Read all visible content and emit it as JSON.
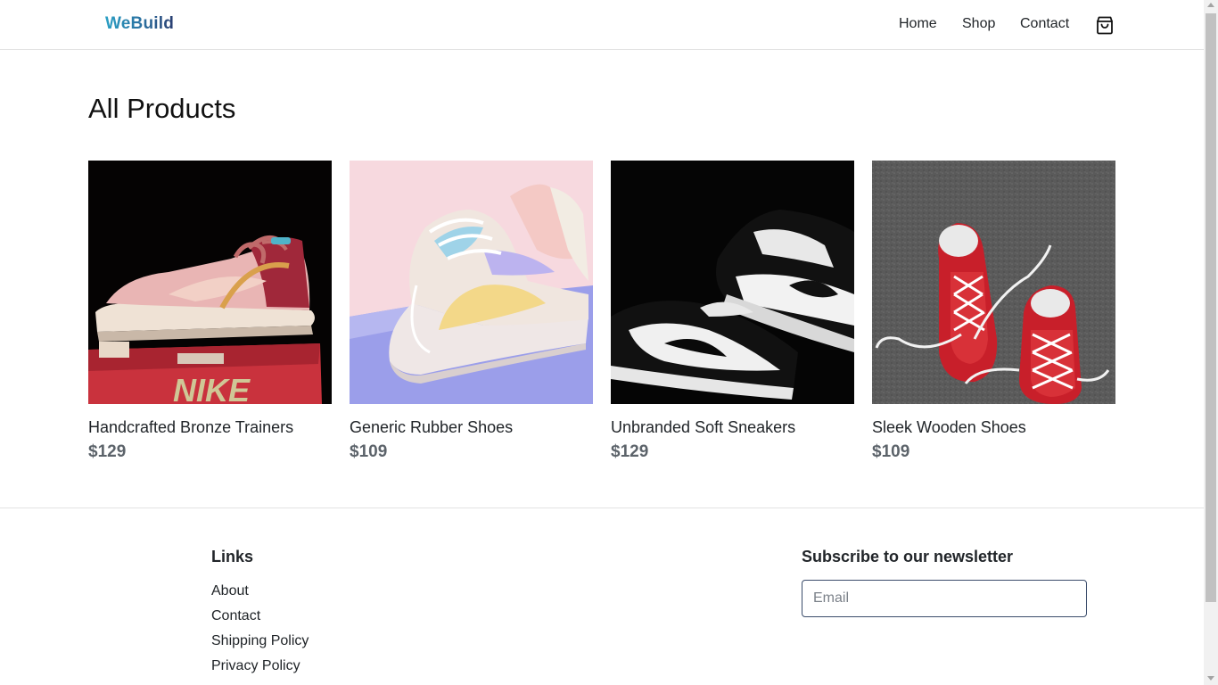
{
  "header": {
    "logo": "WeBuild",
    "nav": [
      "Home",
      "Shop",
      "Contact"
    ],
    "cart_icon": "shopping-bag-icon"
  },
  "main": {
    "title": "All Products",
    "products": [
      {
        "name": "Handcrafted Bronze Trainers",
        "price": "$129",
        "image": "pink-nike-dunk-on-shoebox"
      },
      {
        "name": "Generic Rubber Shoes",
        "price": "$109",
        "image": "pastel-nike-air-force-1"
      },
      {
        "name": "Unbranded Soft Sneakers",
        "price": "$129",
        "image": "black-white-nike-dunk"
      },
      {
        "name": "Sleek Wooden Shoes",
        "price": "$109",
        "image": "red-converse-sneakers"
      }
    ]
  },
  "footer": {
    "links_heading": "Links",
    "links": [
      "About",
      "Contact",
      "Shipping Policy",
      "Privacy Policy"
    ],
    "newsletter_heading": "Subscribe to our newsletter",
    "email_placeholder": "Email"
  },
  "colors": {
    "logo_gradient_start": "#2a9fc4",
    "logo_gradient_end": "#2b3f72",
    "price": "#5c636a",
    "text": "#212529"
  }
}
